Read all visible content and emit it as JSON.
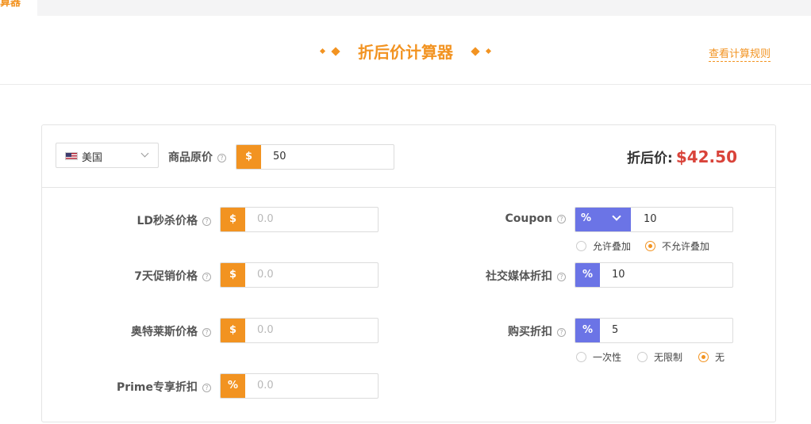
{
  "tab_fragment": "算器",
  "header": {
    "title": "折后价计算器",
    "rules_link": "查看计算规则"
  },
  "country": {
    "selected": "美国"
  },
  "price": {
    "label": "商品原价",
    "prefix": "$",
    "value": "50"
  },
  "final": {
    "label": "折后价:",
    "value": "$42.50"
  },
  "left_fields": [
    {
      "label": "LD秒杀价格",
      "prefix": "$",
      "placeholder": "0.0"
    },
    {
      "label": "7天促销价格",
      "prefix": "$",
      "placeholder": "0.0"
    },
    {
      "label": "奥特莱斯价格",
      "prefix": "$",
      "placeholder": "0.0"
    },
    {
      "label": "Prime专享折扣",
      "prefix": "%",
      "placeholder": "0.0"
    }
  ],
  "coupon": {
    "label": "Coupon",
    "type": "%",
    "value": "10",
    "options": [
      "允许叠加",
      "不允许叠加"
    ],
    "selected": "不允许叠加"
  },
  "social": {
    "label": "社交媒体折扣",
    "prefix": "%",
    "value": "10"
  },
  "purchase": {
    "label": "购买折扣",
    "prefix": "%",
    "value": "5",
    "options": [
      "一次性",
      "无限制",
      "无"
    ],
    "selected": "无"
  },
  "colors": {
    "accent": "#f29321",
    "blue": "#6b74e6",
    "price": "#d9433a"
  }
}
